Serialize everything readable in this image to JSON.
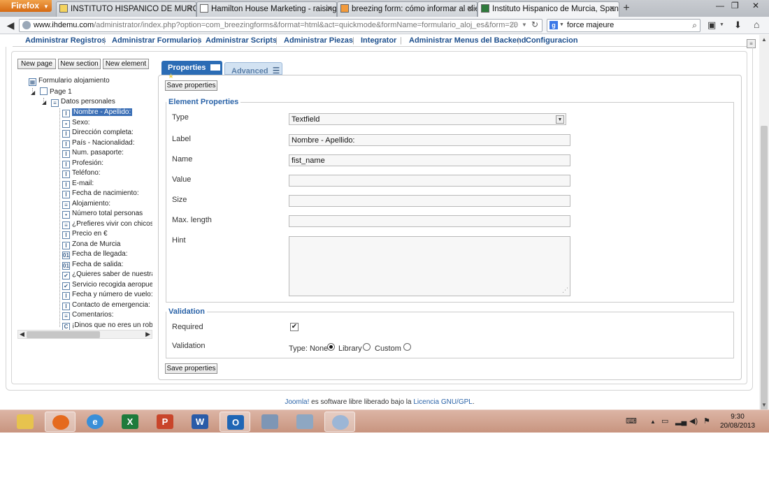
{
  "browser": {
    "menu_button": "Firefox",
    "tabs": [
      {
        "title": "INSTITUTO HISPANICO DE MURCIA"
      },
      {
        "title": "Hamilton House Marketing - raising r..."
      },
      {
        "title": "breezing form: cómo informar al clie..."
      },
      {
        "title": "Instituto Hispanico de Murcia, Spanis..."
      }
    ],
    "url_host": "www.ihdemu.com",
    "url_path": "/administrator/index.php?option=com_breezingforms&format=html&act=quickmode&formName=formulario_aloj_es&form=20",
    "search_text": "force majeure",
    "search_engine_letter": "g"
  },
  "admin_menu": [
    "Administrar Registros",
    "Administrar Formularios",
    "Administrar Scripts",
    "Administrar Piezas",
    "Integrator",
    "Administrar Menus del Backend",
    "Configuracion"
  ],
  "toolbar": {
    "new_page": "New page",
    "new_section": "New section",
    "new_element": "New element"
  },
  "tree": {
    "form": "Formulario alojamiento",
    "page": "Page 1",
    "section": "Datos personales",
    "items": [
      {
        "label": "Nombre - Apellido:",
        "icon": "I"
      },
      {
        "label": "Sexo:",
        "icon": "•"
      },
      {
        "label": "Dirección completa:",
        "icon": "I"
      },
      {
        "label": "País - Nacionalidad:",
        "icon": "I"
      },
      {
        "label": "Num. pasaporte:",
        "icon": "I"
      },
      {
        "label": "Profesión:",
        "icon": "I"
      },
      {
        "label": "Teléfono:",
        "icon": "I"
      },
      {
        "label": "E-mail:",
        "icon": "I"
      },
      {
        "label": "Fecha de nacimiento:",
        "icon": "I"
      },
      {
        "label": "Alojamiento:",
        "icon": "≡"
      },
      {
        "label": "Número total personas",
        "icon": "•"
      },
      {
        "label": "¿Prefieres vivir con chicos, c",
        "icon": "≡"
      },
      {
        "label": "Precio en €",
        "icon": "I"
      },
      {
        "label": "Zona de Murcia",
        "icon": "I"
      },
      {
        "label": "Fecha de llegada:",
        "icon": "01"
      },
      {
        "label": "Fecha de salida:",
        "icon": "01"
      },
      {
        "label": "¿Quieres saber de nuestras c",
        "icon": "✔"
      },
      {
        "label": "Servicio recogida aeropuerto:",
        "icon": "✔"
      },
      {
        "label": "Fecha y número de vuelo:",
        "icon": "I"
      },
      {
        "label": "Contacto de emergencia:",
        "icon": "I"
      },
      {
        "label": "Comentarios:",
        "icon": "≡"
      },
      {
        "label": "¡Dinos que no eres un robot!",
        "icon": "C"
      }
    ]
  },
  "tabs": {
    "properties": "Properties",
    "advanced": "Advanced"
  },
  "save_label": "Save properties",
  "element_properties": {
    "legend": "Element Properties",
    "type_label": "Type",
    "type_value": "Textfield",
    "label_label": "Label",
    "label_value": "Nombre - Apellido:",
    "name_label": "Name",
    "name_value": "fist_name",
    "value_label": "Value",
    "value_value": "",
    "size_label": "Size",
    "size_value": "",
    "maxlength_label": "Max. length",
    "maxlength_value": "",
    "hint_label": "Hint",
    "hint_value": ""
  },
  "validation": {
    "legend": "Validation",
    "required_label": "Required",
    "required_checked": true,
    "validation_label": "Validation",
    "type_prefix": "Type: None",
    "library": "Library",
    "custom": "Custom",
    "selected": "None"
  },
  "footer": {
    "joomla": "Joomla!",
    "text": " es software libre liberado bajo la ",
    "license": "Licencia GNU/GPL",
    "end": "."
  },
  "taskbar": {
    "time": "9:30",
    "date": "20/08/2013"
  }
}
